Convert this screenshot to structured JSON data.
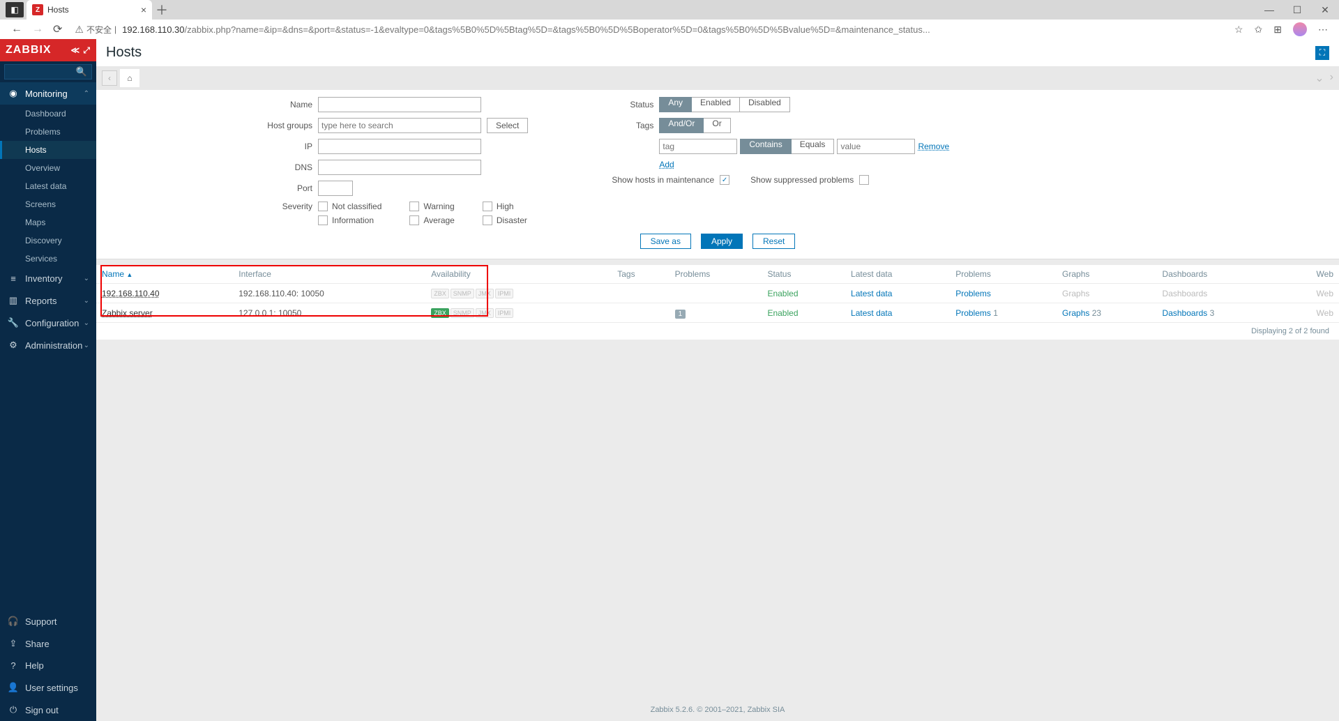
{
  "browser": {
    "tab_title": "Hosts",
    "insecure_label": "不安全",
    "url_host": "192.168.110.30",
    "url_path": "/zabbix.php?name=&ip=&dns=&port=&status=-1&evaltype=0&tags%5B0%5D%5Btag%5D=&tags%5B0%5D%5Boperator%5D=0&tags%5B0%5D%5Bvalue%5D=&maintenance_status..."
  },
  "sidebar": {
    "logo": "ZABBIX",
    "sections": {
      "monitoring": {
        "label": "Monitoring",
        "items": [
          {
            "label": "Dashboard"
          },
          {
            "label": "Problems"
          },
          {
            "label": "Hosts",
            "active": true
          },
          {
            "label": "Overview"
          },
          {
            "label": "Latest data"
          },
          {
            "label": "Screens"
          },
          {
            "label": "Maps"
          },
          {
            "label": "Discovery"
          },
          {
            "label": "Services"
          }
        ]
      },
      "inventory": {
        "label": "Inventory"
      },
      "reports": {
        "label": "Reports"
      },
      "configuration": {
        "label": "Configuration"
      },
      "administration": {
        "label": "Administration"
      }
    },
    "bottom": {
      "support": "Support",
      "share": "Share",
      "help": "Help",
      "user_settings": "User settings",
      "sign_out": "Sign out"
    }
  },
  "page": {
    "title": "Hosts"
  },
  "filter": {
    "labels": {
      "name": "Name",
      "host_groups": "Host groups",
      "ip": "IP",
      "dns": "DNS",
      "port": "Port",
      "severity": "Severity",
      "status": "Status",
      "tags": "Tags",
      "show_maint": "Show hosts in maintenance",
      "show_supp": "Show suppressed problems"
    },
    "host_groups_placeholder": "type here to search",
    "select_btn": "Select",
    "status_opts": {
      "any": "Any",
      "enabled": "Enabled",
      "disabled": "Disabled"
    },
    "tags_opts": {
      "andor": "And/Or",
      "or": "Or"
    },
    "tag_placeholder": "tag",
    "value_placeholder": "value",
    "match_opts": {
      "contains": "Contains",
      "equals": "Equals"
    },
    "remove": "Remove",
    "add": "Add",
    "severity": {
      "not_classified": "Not classified",
      "information": "Information",
      "warning": "Warning",
      "average": "Average",
      "high": "High",
      "disaster": "Disaster"
    },
    "actions": {
      "save_as": "Save as",
      "apply": "Apply",
      "reset": "Reset"
    }
  },
  "table": {
    "headers": {
      "name": "Name",
      "interface": "Interface",
      "availability": "Availability",
      "tags": "Tags",
      "problems": "Problems",
      "status": "Status",
      "latest_data": "Latest data",
      "problems2": "Problems",
      "graphs": "Graphs",
      "dashboards": "Dashboards",
      "web": "Web"
    },
    "rows": [
      {
        "name": "192.168.110.40",
        "interface": "192.168.110.40: 10050",
        "zbx_ok": false,
        "status": "Enabled",
        "latest": "Latest data",
        "problems": "Problems",
        "problems_n": "",
        "graphs": "Graphs",
        "graphs_n": "",
        "dash": "Dashboards",
        "dash_n": "",
        "web": "Web",
        "badge": ""
      },
      {
        "name": "Zabbix server",
        "interface": "127.0.0.1: 10050",
        "zbx_ok": true,
        "status": "Enabled",
        "latest": "Latest data",
        "problems": "Problems",
        "problems_n": "1",
        "graphs": "Graphs",
        "graphs_n": "23",
        "dash": "Dashboards",
        "dash_n": "3",
        "web": "Web",
        "badge": "1"
      }
    ],
    "footer": "Displaying 2 of 2 found"
  },
  "zfooter": {
    "text": "Zabbix 5.2.6. © 2001–2021, ",
    "link": "Zabbix SIA"
  }
}
